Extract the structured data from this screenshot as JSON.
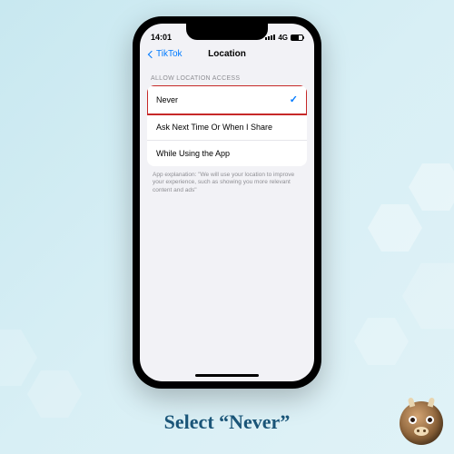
{
  "status": {
    "time": "14:01",
    "network_label": "4G"
  },
  "nav": {
    "back_label": "TikTok",
    "title": "Location"
  },
  "section": {
    "header": "ALLOW LOCATION ACCESS",
    "options": [
      {
        "label": "Never",
        "selected": true,
        "highlighted": true
      },
      {
        "label": "Ask Next Time Or When I Share",
        "selected": false,
        "highlighted": false
      },
      {
        "label": "While Using the App",
        "selected": false,
        "highlighted": false
      }
    ],
    "explanation": "App explanation: \"We will use your location to improve your experience, such as showing you more relevant content and ads\""
  },
  "instruction": "Select “Never”",
  "colors": {
    "accent": "#007aff",
    "highlight_border": "#c62828",
    "instruction_text": "#1a5578"
  }
}
